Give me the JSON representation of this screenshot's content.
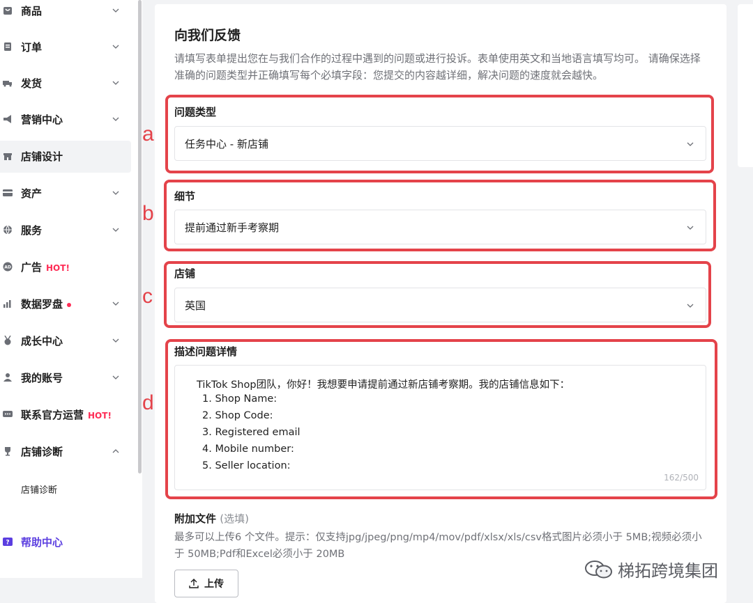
{
  "sidebar": {
    "items": [
      {
        "label": "商品",
        "icon": "bag-icon"
      },
      {
        "label": "订单",
        "icon": "order-icon"
      },
      {
        "label": "发货",
        "icon": "truck-icon"
      },
      {
        "label": "营销中心",
        "icon": "megaphone-icon"
      },
      {
        "label": "店铺设计",
        "icon": "store-icon"
      },
      {
        "label": "资产",
        "icon": "card-icon"
      },
      {
        "label": "服务",
        "icon": "globe-icon"
      },
      {
        "label": "广告",
        "icon": "ad-icon",
        "badge": "HOT!"
      },
      {
        "label": "数据罗盘",
        "icon": "chart-icon"
      },
      {
        "label": "成长中心",
        "icon": "medal-icon"
      },
      {
        "label": "我的账号",
        "icon": "user-icon"
      },
      {
        "label": "联系官方运营",
        "icon": "chat-icon",
        "badge": "HOT!"
      },
      {
        "label": "店铺诊断",
        "icon": "trophy-icon"
      }
    ],
    "sub_item": "店铺诊断",
    "help": "帮助中心"
  },
  "form": {
    "title": "向我们反馈",
    "description": "请填写表单提出您在与我们合作的过程中遇到的问题或进行投诉。表单使用英文和当地语言填写均可。 请确保选择准确的问题类型并正确填写每个必填字段：您提交的内容越详细，解决问题的速度就会越快。",
    "issue_type": {
      "label": "问题类型",
      "value": "任务中心 - 新店铺"
    },
    "detail": {
      "label": "细节",
      "value": "提前通过新手考察期"
    },
    "store": {
      "label": "店铺",
      "value": "英国"
    },
    "description_field": {
      "label": "描述问题详情",
      "lines": [
        "TikTok Shop团队，你好！我想要申请提前通过新店铺考察期。我的店铺信息如下：",
        "1. Shop Name:",
        "2. Shop Code:",
        "3. Registered email",
        "4. Mobile number:",
        "5. Seller location:"
      ],
      "counter": "162/500"
    },
    "attachment": {
      "label": "附加文件",
      "optional": "(选填)",
      "hint": "最多可以上传6 个文件。提示：仅支持jpg/jpeg/png/mp4/mov/pdf/xlsx/xls/csv格式图片必须小于 5MB;视频必须小于 50MB;Pdf和Excel必须小于 20MB",
      "upload_label": "上传"
    }
  },
  "annotations": [
    "a",
    "b",
    "c",
    "d"
  ],
  "watermark": "梯拓跨境集团",
  "colors": {
    "accent": "#5b3ee0",
    "hot": "#fe2c55",
    "highlight": "#e4434a"
  }
}
